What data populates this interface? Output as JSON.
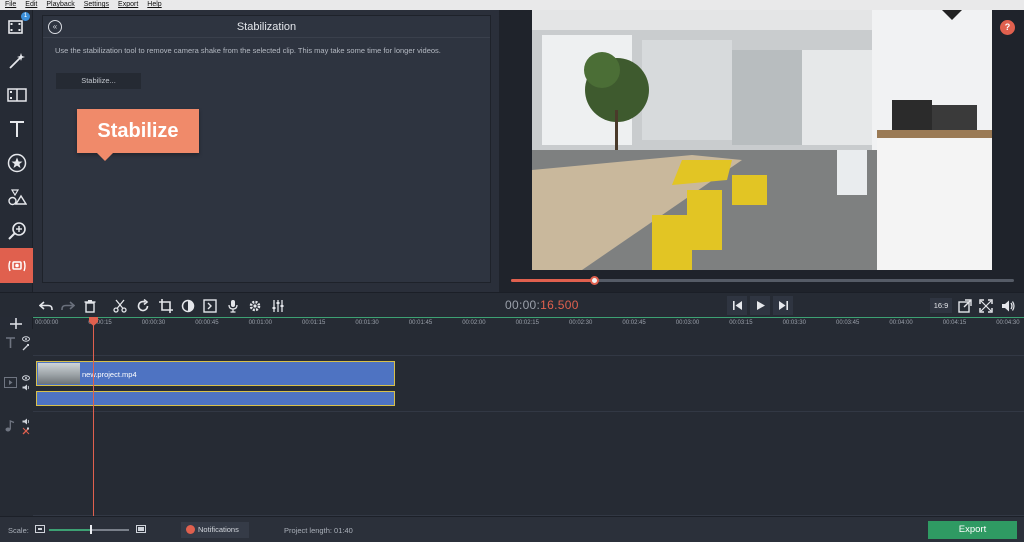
{
  "menu": [
    "File",
    "Edit",
    "Playback",
    "Settings",
    "Export",
    "Help"
  ],
  "sidebar": {
    "import_badge": "1",
    "items": [
      {
        "icon": "import-icon"
      },
      {
        "icon": "magic-wand-icon"
      },
      {
        "icon": "transitions-icon"
      },
      {
        "icon": "titles-icon"
      },
      {
        "icon": "stickers-icon"
      },
      {
        "icon": "shapes-icon"
      },
      {
        "icon": "zoom-icon"
      },
      {
        "icon": "stabilization-icon",
        "active": true
      },
      {
        "icon": "more-tools-icon"
      }
    ]
  },
  "panel": {
    "back_label": "«",
    "title": "Stabilization",
    "description": "Use the stabilization tool to remove camera shake from the selected clip. This may take some time for longer videos.",
    "stabilize_button": "Stabilize...",
    "callout": "Stabilize"
  },
  "preview": {
    "help_label": "?",
    "seek_fraction": 0.165
  },
  "player": {
    "time_prefix": "00:00:",
    "time_highlight": "16.500",
    "aspect_ratio": "16:9"
  },
  "timeline": {
    "ruler_labels": [
      "00:00:00",
      "00:00:15",
      "00:00:30",
      "00:00:45",
      "00:01:00",
      "00:01:15",
      "00:01:30",
      "00:01:45",
      "00:02:00",
      "00:02:15",
      "00:02:30",
      "00:02:45",
      "00:03:00",
      "00:03:15",
      "00:03:30",
      "00:03:45",
      "00:04:00",
      "00:04:15",
      "00:04:30"
    ],
    "clip_name": "new.project.mp4"
  },
  "status": {
    "scale_label": "Scale:",
    "scale_fraction": 0.52,
    "notifications": "Notifications",
    "project_length": "Project length:  01:40",
    "export": "Export"
  },
  "colors": {
    "accent": "#e0604e",
    "clip": "#4e73c2",
    "export": "#2f9a63",
    "callout": "#f08a6a"
  }
}
